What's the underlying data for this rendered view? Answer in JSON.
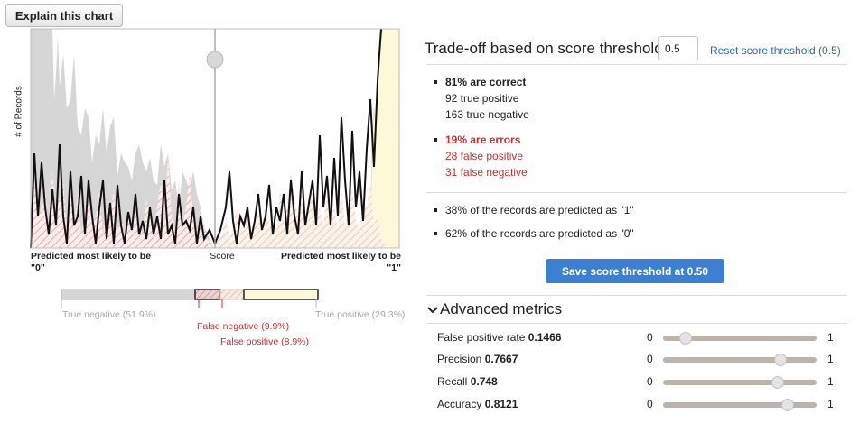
{
  "explain_button": "Explain this chart",
  "chart": {
    "y_axis_label": "# of Records",
    "x_left_label_line1": "Predicted most likely to be",
    "x_left_label_line2": "\"0\"",
    "x_mid_label": "Score",
    "x_right_label_line1": "Predicted most likely to be",
    "x_right_label_line2": "\"1\"",
    "threshold": 0.5
  },
  "chart_data": {
    "type": "area",
    "title": "",
    "xlabel": "Score",
    "ylabel": "# of Records",
    "xlim": [
      0,
      1
    ],
    "threshold": 0.5,
    "series": [
      {
        "name": "True negative",
        "color": "#d9d9d9"
      },
      {
        "name": "False negative",
        "color": "#d62b2b"
      },
      {
        "name": "False positive",
        "color": "#c9a98e"
      },
      {
        "name": "True positive",
        "color": "#fdf8d8"
      }
    ]
  },
  "distribution_bar": {
    "legend": {
      "true_negative": "True negative (51.9%)",
      "false_negative": "False negative (9.9%)",
      "false_positive": "False positive (8.9%)",
      "true_positive": "True positive (29.3%)"
    },
    "fractions": {
      "true_negative": 0.519,
      "false_negative": 0.099,
      "false_positive": 0.089,
      "true_positive": 0.293
    }
  },
  "tradeoff": {
    "title": "Trade-off based on score threshold",
    "threshold_value": "0.5",
    "reset_link": "Reset score threshold (0.5)",
    "correct_heading": "81% are correct",
    "true_positive": "92 true positive",
    "true_negative": "163 true negative",
    "errors_heading": "19% are errors",
    "false_positive": "28 false positive",
    "false_negative": "31 false negative",
    "predicted_1": "38% of the records are predicted as \"1\"",
    "predicted_0": "62% of the records are predicted as \"0\"",
    "save_button": "Save score threshold at 0.50"
  },
  "advanced": {
    "title": "Advanced metrics",
    "chevron_icon": "chevron-down-icon",
    "min_label": "0",
    "max_label": "1",
    "metrics": [
      {
        "label": "False positive rate",
        "value": "0.1466",
        "level": 0.1466
      },
      {
        "label": "Precision",
        "value": "0.7667",
        "level": 0.7667
      },
      {
        "label": "Recall",
        "value": "0.748",
        "level": 0.748
      },
      {
        "label": "Accuracy",
        "value": "0.8121",
        "level": 0.8121
      }
    ]
  }
}
